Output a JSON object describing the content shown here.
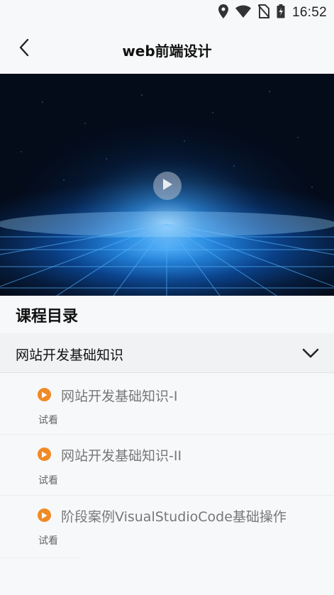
{
  "status_bar": {
    "time": "16:52",
    "icons": [
      "location-icon",
      "wifi-icon",
      "no-sim-icon",
      "battery-icon"
    ]
  },
  "nav": {
    "title": "web前端设计",
    "back_icon": "chevron-left-icon"
  },
  "video": {
    "play_icon": "play-icon"
  },
  "catalog": {
    "title": "课程目录",
    "chapter": {
      "title": "网站开发基础知识",
      "expanded": true,
      "toggle_icon": "chevron-down-icon"
    },
    "lessons": [
      {
        "title": "网站开发基础知识-I",
        "badge": "试看"
      },
      {
        "title": "网站开发基础知识-II",
        "badge": "试看"
      },
      {
        "title": "阶段案例VisualStudioCode基础操作",
        "badge": "试看"
      }
    ]
  },
  "colors": {
    "accent": "#f08a24",
    "background": "#f7f8fa",
    "chapter_bg": "#f1f2f4",
    "lesson_text": "#777777"
  }
}
